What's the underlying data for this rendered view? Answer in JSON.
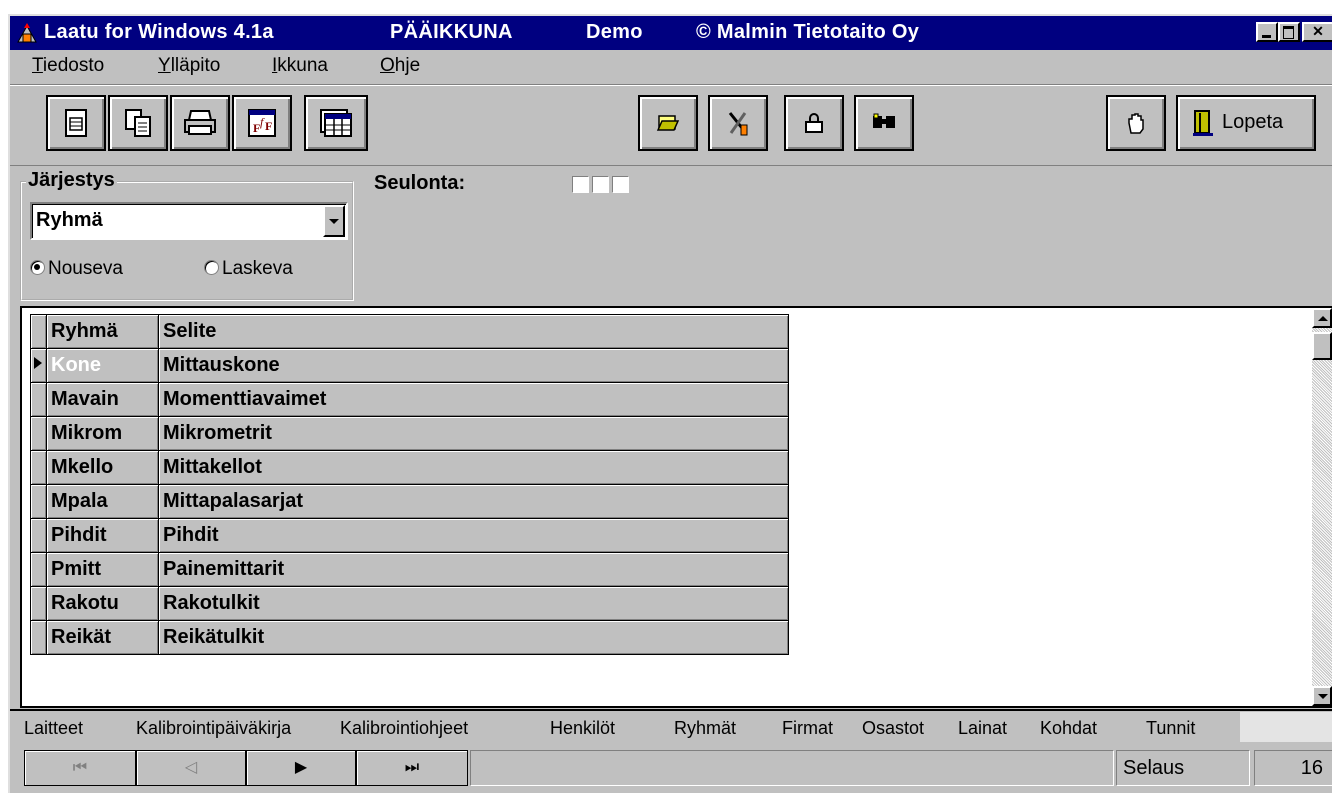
{
  "title": {
    "app": "Laatu for Windows 4.1a",
    "window": "PÄÄIKKUNA",
    "mode": "Demo",
    "copyright": "© Malmin Tietotaito Oy"
  },
  "menu": [
    {
      "label": "Tiedosto"
    },
    {
      "label": "Ylläpito"
    },
    {
      "label": "Ikkuna"
    },
    {
      "label": "Ohje"
    }
  ],
  "toolbar": {
    "buttons": [
      "new-document-icon",
      "copy-icon",
      "print-icon",
      "formula-icon",
      "table-icon",
      "open-folder-icon",
      "tools-icon",
      "lock-icon",
      "find-icon",
      "hand-icon"
    ],
    "exit_label": "Lopeta"
  },
  "sort": {
    "legend": "Järjestys",
    "selected": "Ryhmä",
    "ascending": "Nouseva",
    "descending": "Laskeva",
    "ascending_checked": true
  },
  "filter": {
    "label": "Seulonta:"
  },
  "grid": {
    "headers": [
      "Ryhmä",
      "Selite"
    ],
    "rows": [
      {
        "group": "Kone",
        "desc": "Mittauskone",
        "current": true
      },
      {
        "group": "Mavain",
        "desc": "Momenttiavaimet"
      },
      {
        "group": "Mikrom",
        "desc": "Mikrometrit"
      },
      {
        "group": "Mkello",
        "desc": "Mittakellot"
      },
      {
        "group": "Mpala",
        "desc": "Mittapalasarjat"
      },
      {
        "group": "Pihdit",
        "desc": "Pihdit"
      },
      {
        "group": "Pmitt",
        "desc": "Painemittarit"
      },
      {
        "group": "Rakotu",
        "desc": "Rakotulkit"
      },
      {
        "group": "Reikät",
        "desc": "Reikätulkit"
      }
    ]
  },
  "tabs": [
    "Laitteet",
    "Kalibrointipäiväkirja",
    "Kalibrointiohjeet",
    "Henkilöt",
    "Ryhmät",
    "Firmat",
    "Osastot",
    "Lainat",
    "Kohdat",
    "Tunnit"
  ],
  "active_tab": "Ryhmät",
  "status": {
    "mode": "Selaus",
    "count": "16"
  }
}
